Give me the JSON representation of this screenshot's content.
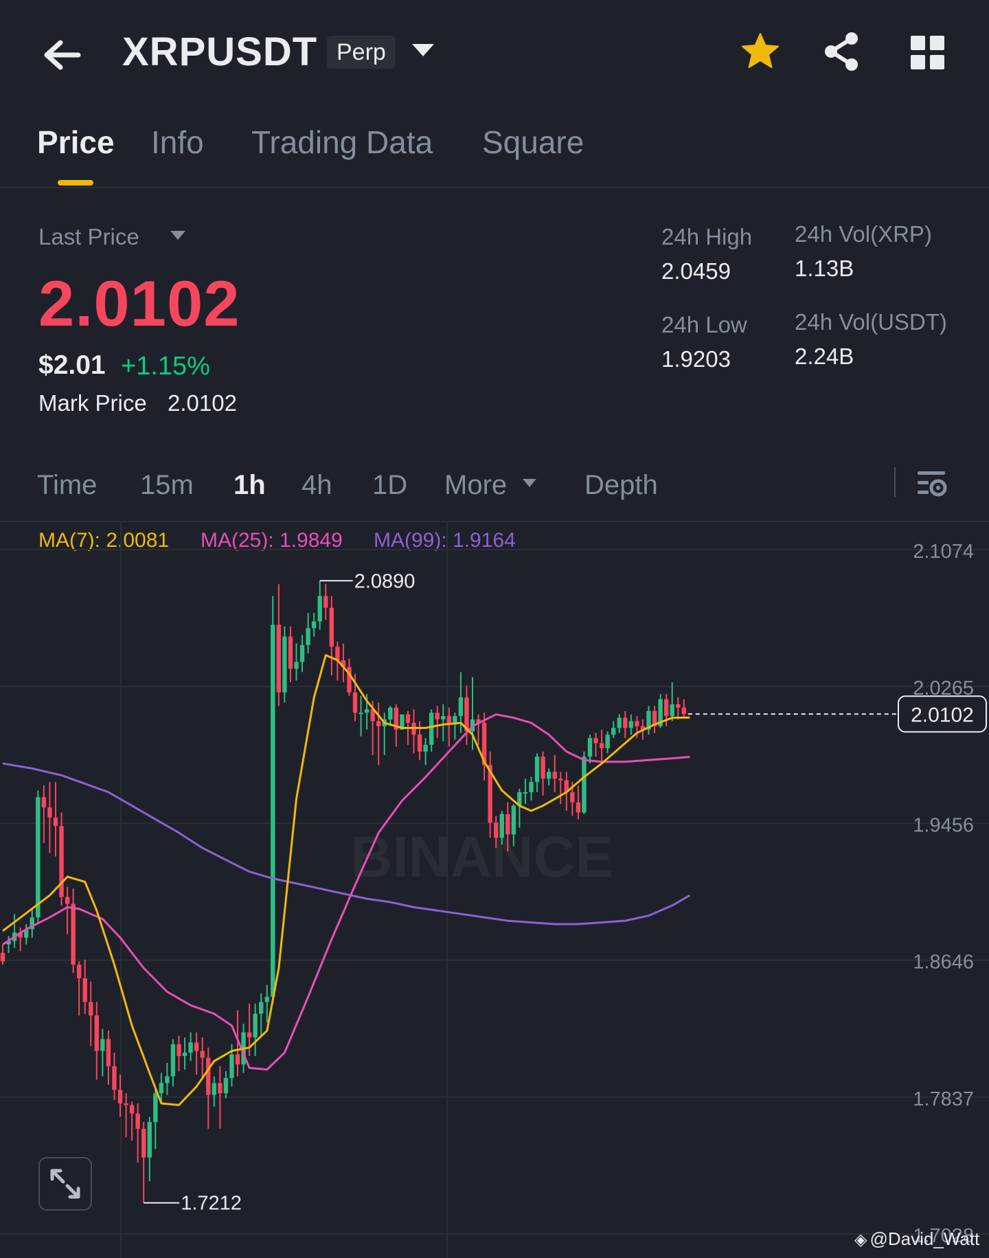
{
  "header": {
    "symbol": "XRPUSDT",
    "badge": "Perp",
    "icons": [
      "back-arrow-icon",
      "chevron-down-icon",
      "star-icon",
      "share-icon",
      "grid-icon"
    ],
    "star_color": "#f0b90b"
  },
  "tabs": [
    {
      "label": "Price",
      "active": true
    },
    {
      "label": "Info",
      "active": false
    },
    {
      "label": "Trading Data",
      "active": false
    },
    {
      "label": "Square",
      "active": false
    }
  ],
  "price": {
    "last_price_label": "Last Price",
    "last_price": "2.0102",
    "usd_price": "$2.01",
    "change": "+1.15%",
    "mark_label": "Mark Price",
    "mark_value": "2.0102",
    "last_price_color": "#f6465d",
    "change_color": "#0ecb81"
  },
  "stats": {
    "high_label": "24h High",
    "high_value": "2.0459",
    "low_label": "24h Low",
    "low_value": "1.9203",
    "vol_xrp_label": "24h Vol(XRP)",
    "vol_xrp_value": "1.13B",
    "vol_usdt_label": "24h Vol(USDT)",
    "vol_usdt_value": "2.24B"
  },
  "intervals": [
    {
      "label": "Time",
      "active": false
    },
    {
      "label": "15m",
      "active": false
    },
    {
      "label": "1h",
      "active": true
    },
    {
      "label": "4h",
      "active": false
    },
    {
      "label": "1D",
      "active": false
    },
    {
      "label": "More",
      "active": false
    },
    {
      "label": "Depth",
      "active": false
    }
  ],
  "ma_legend": {
    "ma7": "MA(7): 2.0081",
    "ma25": "MA(25): 1.9849",
    "ma99": "MA(99): 1.9164"
  },
  "chart_data": {
    "type": "candlestick",
    "y_ticks": [
      "2.1074",
      "2.0265",
      "1.9456",
      "1.8646",
      "1.7837",
      "1.7028"
    ],
    "ylim": [
      1.7028,
      2.1074
    ],
    "current_price_label": "2.0102",
    "current_price": 2.0102,
    "high_marker": {
      "label": "2.0890",
      "value": 2.089,
      "index": 54
    },
    "low_marker": {
      "label": "1.7212",
      "value": 1.7212,
      "index": 24
    },
    "watermark_text": "BINANCE",
    "up_color": "#2ebd85",
    "down_color": "#f6465d",
    "candles": [
      [
        1.869,
        1.874,
        1.864,
        1.862
      ],
      [
        1.874,
        1.879,
        1.876,
        1.869
      ],
      [
        1.876,
        1.892,
        1.881,
        1.872
      ],
      [
        1.881,
        1.884,
        1.878,
        1.87
      ],
      [
        1.878,
        1.886,
        1.883,
        1.874
      ],
      [
        1.883,
        1.895,
        1.89,
        1.878
      ],
      [
        1.89,
        1.965,
        1.961,
        1.886
      ],
      [
        1.961,
        1.968,
        1.955,
        1.934
      ],
      [
        1.955,
        1.97,
        1.949,
        1.928
      ],
      [
        1.949,
        1.97,
        1.944,
        1.926
      ],
      [
        1.944,
        1.952,
        1.902,
        1.897
      ],
      [
        1.902,
        1.908,
        1.898,
        1.88
      ],
      [
        1.898,
        1.907,
        1.862,
        1.857
      ],
      [
        1.862,
        1.864,
        1.854,
        1.832
      ],
      [
        1.854,
        1.865,
        1.84,
        1.833
      ],
      [
        1.84,
        1.852,
        1.832,
        1.814
      ],
      [
        1.832,
        1.84,
        1.811,
        1.794
      ],
      [
        1.811,
        1.824,
        1.818,
        1.796
      ],
      [
        1.818,
        1.823,
        1.802,
        1.791
      ],
      [
        1.802,
        1.81,
        1.788,
        1.782
      ],
      [
        1.788,
        1.797,
        1.78,
        1.772
      ],
      [
        1.78,
        1.786,
        1.779,
        1.76
      ],
      [
        1.779,
        1.781,
        1.774,
        1.758
      ],
      [
        1.774,
        1.78,
        1.765,
        1.745
      ],
      [
        1.765,
        1.769,
        1.748,
        1.7212
      ],
      [
        1.748,
        1.772,
        1.769,
        1.734
      ],
      [
        1.769,
        1.79,
        1.786,
        1.753
      ],
      [
        1.786,
        1.798,
        1.792,
        1.78
      ],
      [
        1.792,
        1.804,
        1.796,
        1.785
      ],
      [
        1.796,
        1.818,
        1.815,
        1.79
      ],
      [
        1.815,
        1.82,
        1.808,
        1.799
      ],
      [
        1.808,
        1.819,
        1.81,
        1.8
      ],
      [
        1.81,
        1.822,
        1.816,
        1.805
      ],
      [
        1.816,
        1.822,
        1.811,
        1.797
      ],
      [
        1.811,
        1.819,
        1.807,
        1.794
      ],
      [
        1.807,
        1.813,
        1.785,
        1.765
      ],
      [
        1.785,
        1.796,
        1.792,
        1.778
      ],
      [
        1.792,
        1.802,
        1.786,
        1.765
      ],
      [
        1.786,
        1.799,
        1.795,
        1.783
      ],
      [
        1.795,
        1.815,
        1.809,
        1.79
      ],
      [
        1.809,
        1.835,
        1.803,
        1.796
      ],
      [
        1.803,
        1.827,
        1.822,
        1.798
      ],
      [
        1.822,
        1.839,
        1.819,
        1.808
      ],
      [
        1.819,
        1.839,
        1.833,
        1.808
      ],
      [
        1.833,
        1.845,
        1.84,
        1.82
      ],
      [
        1.84,
        1.85,
        1.843,
        1.828
      ],
      [
        1.843,
        2.08,
        2.063,
        1.839
      ],
      [
        2.063,
        2.087,
        2.023,
        2.015
      ],
      [
        2.023,
        2.062,
        2.056,
        2.017
      ],
      [
        2.056,
        2.062,
        2.037,
        2.029
      ],
      [
        2.037,
        2.052,
        2.041,
        2.03
      ],
      [
        2.041,
        2.057,
        2.051,
        2.035
      ],
      [
        2.051,
        2.07,
        2.061,
        2.046
      ],
      [
        2.061,
        2.07,
        2.065,
        2.056
      ],
      [
        2.065,
        2.089,
        2.08,
        2.06
      ],
      [
        2.08,
        2.087,
        2.073,
        2.066
      ],
      [
        2.073,
        2.08,
        2.05,
        2.033
      ],
      [
        2.05,
        2.053,
        2.042,
        2.03
      ],
      [
        2.042,
        2.052,
        2.038,
        2.029
      ],
      [
        2.038,
        2.043,
        2.023,
        2.021
      ],
      [
        2.023,
        2.034,
        2.011,
        2.006
      ],
      [
        2.011,
        2.021,
        2.011,
        1.997
      ],
      [
        2.011,
        2.022,
        2.013,
        2.001
      ],
      [
        2.013,
        2.018,
        2.006,
        1.986
      ],
      [
        2.006,
        2.017,
        2.003,
        1.98
      ],
      [
        2.003,
        2.011,
        2.007,
        1.986
      ],
      [
        2.007,
        2.015,
        2.014,
        2.003
      ],
      [
        2.014,
        2.016,
        2.001,
        1.991
      ],
      [
        2.001,
        2.009,
        2.01,
        2.008
      ],
      [
        2.01,
        2.012,
        2.005,
        1.992
      ],
      [
        2.005,
        2.013,
        1.998,
        1.987
      ],
      [
        1.998,
        2.006,
        1.988,
        1.983
      ],
      [
        1.988,
        1.996,
        1.992,
        1.98
      ],
      [
        1.992,
        2.013,
        2.011,
        1.988
      ],
      [
        2.011,
        2.015,
        2.007,
        1.996
      ],
      [
        2.007,
        2.016,
        2.009,
        1.994
      ],
      [
        2.009,
        2.014,
        2.004,
        1.991
      ],
      [
        2.004,
        2.011,
        2.009,
        1.995
      ],
      [
        2.009,
        2.035,
        2.02,
        1.999
      ],
      [
        2.02,
        2.027,
        2.0,
        1.992
      ],
      [
        2.0,
        2.032,
        2.007,
        1.989
      ],
      [
        2.007,
        2.01,
        2.005,
        1.992
      ],
      [
        2.005,
        2.011,
        1.98,
        1.971
      ],
      [
        1.98,
        1.988,
        1.946,
        1.937
      ],
      [
        1.946,
        1.95,
        1.937,
        1.931
      ],
      [
        1.937,
        1.953,
        1.951,
        1.933
      ],
      [
        1.951,
        1.958,
        1.939,
        1.929
      ],
      [
        1.939,
        1.957,
        1.956,
        1.932
      ],
      [
        1.956,
        1.966,
        1.964,
        1.943
      ],
      [
        1.964,
        1.972,
        1.964,
        1.957
      ],
      [
        1.964,
        1.973,
        1.97,
        1.959
      ],
      [
        1.97,
        1.987,
        1.985,
        1.964
      ],
      [
        1.985,
        1.988,
        1.972,
        1.962
      ],
      [
        1.972,
        1.978,
        1.976,
        1.968
      ],
      [
        1.976,
        1.986,
        1.972,
        1.964
      ],
      [
        1.972,
        1.976,
        1.971,
        1.957
      ],
      [
        1.971,
        1.976,
        1.964,
        1.953
      ],
      [
        1.964,
        1.97,
        1.958,
        1.95
      ],
      [
        1.958,
        1.968,
        1.952,
        1.948
      ],
      [
        1.952,
        1.988,
        1.985,
        1.951
      ],
      [
        1.985,
        1.998,
        1.996,
        1.981
      ],
      [
        1.996,
        1.999,
        1.993,
        1.985
      ],
      [
        1.993,
        2.001,
        1.99,
        1.982
      ],
      [
        1.99,
        2.0,
        1.998,
        1.987
      ],
      [
        1.998,
        2.006,
        2.002,
        1.996
      ],
      [
        2.002,
        2.01,
        2.008,
        1.999
      ],
      [
        2.008,
        2.012,
        2.002,
        1.996
      ],
      [
        2.002,
        2.01,
        2.006,
        1.998
      ],
      [
        2.006,
        2.009,
        2.003,
        1.996
      ],
      [
        2.003,
        2.007,
        2.001,
        1.995
      ],
      [
        2.001,
        2.015,
        2.012,
        1.998
      ],
      [
        2.012,
        2.015,
        2.003,
        1.999
      ],
      [
        2.003,
        2.022,
        2.019,
        2.002
      ],
      [
        2.019,
        2.022,
        2.009,
        2.003
      ],
      [
        2.009,
        2.029,
        2.016,
        2.006
      ],
      [
        2.016,
        2.02,
        2.014,
        2.007
      ],
      [
        2.014,
        2.019,
        2.0102,
        2.008
      ]
    ],
    "ma7": [
      [
        0,
        1.882
      ],
      [
        8,
        1.903
      ],
      [
        11,
        1.914
      ],
      [
        14,
        1.911
      ],
      [
        16,
        1.894
      ],
      [
        19,
        1.862
      ],
      [
        22,
        1.826
      ],
      [
        25,
        1.798
      ],
      [
        27,
        1.78
      ],
      [
        30,
        1.779
      ],
      [
        33,
        1.79
      ],
      [
        36,
        1.805
      ],
      [
        39,
        1.811
      ],
      [
        42,
        1.813
      ],
      [
        45,
        1.823
      ],
      [
        47,
        1.86
      ],
      [
        50,
        1.96
      ],
      [
        53,
        2.02
      ],
      [
        55,
        2.045
      ],
      [
        57,
        2.042
      ],
      [
        59,
        2.034
      ],
      [
        62,
        2.018
      ],
      [
        65,
        2.005
      ],
      [
        68,
        2.002
      ],
      [
        72,
        2.002
      ],
      [
        75,
        2.004
      ],
      [
        78,
        2.005
      ],
      [
        80,
        1.998
      ],
      [
        82,
        1.982
      ],
      [
        85,
        1.965
      ],
      [
        88,
        1.956
      ],
      [
        90,
        1.953
      ],
      [
        92,
        1.956
      ],
      [
        94,
        1.96
      ],
      [
        96,
        1.964
      ],
      [
        99,
        1.973
      ],
      [
        102,
        1.981
      ],
      [
        105,
        1.99
      ],
      [
        108,
        1.999
      ],
      [
        111,
        2.004
      ],
      [
        114,
        2.008
      ],
      [
        117,
        2.0081
      ]
    ],
    "ma25": [
      [
        0,
        1.874
      ],
      [
        4,
        1.883
      ],
      [
        8,
        1.89
      ],
      [
        11,
        1.896
      ],
      [
        13,
        1.895
      ],
      [
        17,
        1.889
      ],
      [
        20,
        1.878
      ],
      [
        24,
        1.86
      ],
      [
        28,
        1.846
      ],
      [
        32,
        1.838
      ],
      [
        36,
        1.833
      ],
      [
        39,
        1.826
      ],
      [
        42,
        1.801
      ],
      [
        45,
        1.8
      ],
      [
        48,
        1.81
      ],
      [
        52,
        1.843
      ],
      [
        56,
        1.877
      ],
      [
        60,
        1.909
      ],
      [
        64,
        1.94
      ],
      [
        68,
        1.959
      ],
      [
        72,
        1.973
      ],
      [
        76,
        1.988
      ],
      [
        80,
        2.003
      ],
      [
        84,
        2.01
      ],
      [
        87,
        2.008
      ],
      [
        90,
        2.005
      ],
      [
        93,
        1.998
      ],
      [
        96,
        1.988
      ],
      [
        99,
        1.983
      ],
      [
        102,
        1.982
      ],
      [
        106,
        1.982
      ],
      [
        110,
        1.983
      ],
      [
        114,
        1.984
      ],
      [
        117,
        1.9849
      ]
    ],
    "ma99": [
      [
        0,
        1.981
      ],
      [
        5,
        1.978
      ],
      [
        10,
        1.974
      ],
      [
        14,
        1.969
      ],
      [
        18,
        1.964
      ],
      [
        22,
        1.956
      ],
      [
        26,
        1.948
      ],
      [
        30,
        1.94
      ],
      [
        34,
        1.931
      ],
      [
        38,
        1.924
      ],
      [
        42,
        1.917
      ],
      [
        46,
        1.913
      ],
      [
        50,
        1.91
      ],
      [
        54,
        1.907
      ],
      [
        58,
        1.904
      ],
      [
        62,
        1.901
      ],
      [
        66,
        1.899
      ],
      [
        70,
        1.896
      ],
      [
        74,
        1.894
      ],
      [
        78,
        1.892
      ],
      [
        82,
        1.89
      ],
      [
        86,
        1.888
      ],
      [
        90,
        1.887
      ],
      [
        94,
        1.886
      ],
      [
        98,
        1.886
      ],
      [
        102,
        1.887
      ],
      [
        106,
        1.888
      ],
      [
        110,
        1.891
      ],
      [
        114,
        1.897
      ],
      [
        117,
        1.903
      ]
    ]
  },
  "watermark": "@David_Watt"
}
